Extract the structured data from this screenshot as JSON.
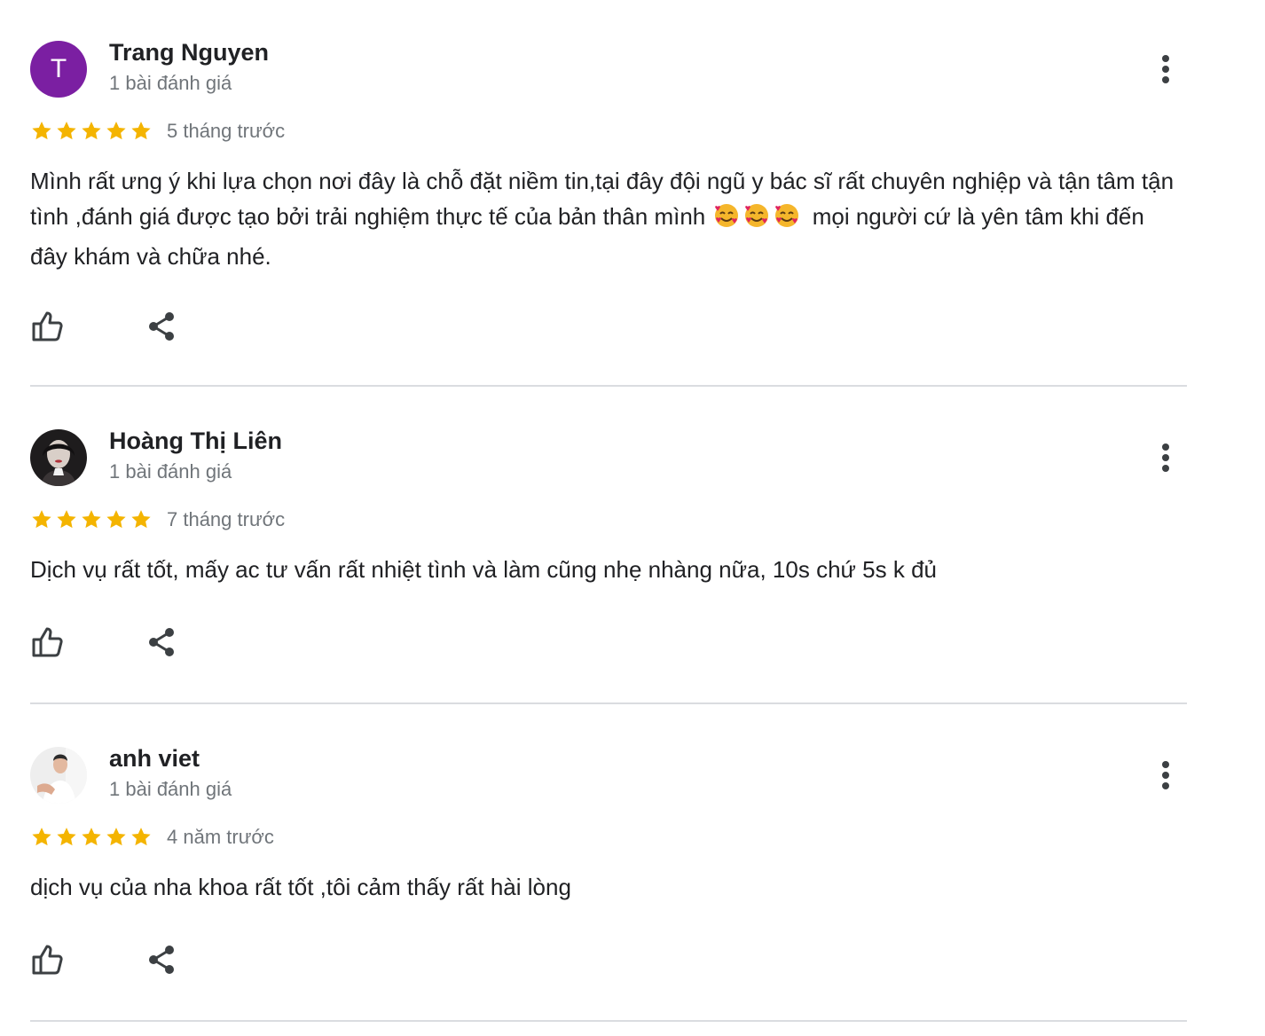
{
  "colors": {
    "star": "#f4b400",
    "avatar_purple": "#7b1fa2",
    "secondary_text": "#70757a",
    "divider": "#dadce0"
  },
  "reviews": [
    {
      "author": "Trang Nguyen",
      "avatar_letter": "T",
      "review_count": "1 bài đánh giá",
      "rating": 5,
      "date": "5 tháng trước",
      "text_part1": "Mình rất ưng ý khi lựa chọn nơi đây là chỗ đặt niềm tin,tại đây đội ngũ y bác sĩ rất chuyên nghiệp và tận tâm tận tình ,đánh giá được tạo bởi trải nghiệm thực tế của bản thân mình",
      "emoji": "smiling-face-with-hearts",
      "text_part2": "mọi người cứ là yên tâm khi đến đây khám và chữa nhé."
    },
    {
      "author": "Hoàng Thị Liên",
      "review_count": "1 bài đánh giá",
      "rating": 5,
      "date": "7 tháng trước",
      "text": "Dịch vụ rất tốt, mấy ac tư vấn rất nhiệt tình và làm cũng nhẹ nhàng nữa, 10s chứ 5s k đủ"
    },
    {
      "author": "anh viet",
      "review_count": "1 bài đánh giá",
      "rating": 5,
      "date": "4 năm trước",
      "text": "dịch vụ của nha khoa rất tốt ,tôi cảm thấy rất hài lòng"
    }
  ],
  "icons": {
    "more": "more-vert-icon",
    "like": "thumb-up-icon",
    "share": "share-icon",
    "star": "star-icon"
  }
}
